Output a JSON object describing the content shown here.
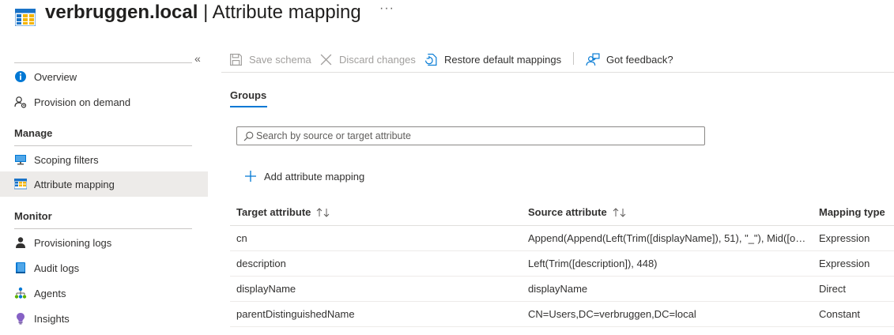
{
  "header": {
    "title_main": "verbruggen.local",
    "title_separator": "|",
    "title_sub": "Attribute mapping",
    "more": "···"
  },
  "sidebar": {
    "collapse_glyph": "«",
    "items": [
      {
        "label": "Overview",
        "icon": "info-icon"
      },
      {
        "label": "Provision on demand",
        "icon": "provision-icon"
      }
    ],
    "manage": {
      "heading": "Manage",
      "items": [
        {
          "label": "Scoping filters",
          "icon": "monitor-icon"
        },
        {
          "label": "Attribute mapping",
          "icon": "table-icon",
          "active": true
        }
      ]
    },
    "monitor": {
      "heading": "Monitor",
      "items": [
        {
          "label": "Provisioning logs",
          "icon": "person-icon"
        },
        {
          "label": "Audit logs",
          "icon": "book-icon"
        },
        {
          "label": "Agents",
          "icon": "org-icon"
        },
        {
          "label": "Insights",
          "icon": "lightbulb-icon"
        }
      ]
    }
  },
  "toolbar": {
    "save_label": "Save schema",
    "discard_label": "Discard changes",
    "restore_label": "Restore default mappings",
    "feedback_label": "Got feedback?"
  },
  "tab": {
    "label": "Groups"
  },
  "search": {
    "placeholder": "Search by source or target attribute"
  },
  "add_mapping_label": "Add attribute mapping",
  "table": {
    "headers": [
      "Target attribute",
      "Source attribute",
      "Mapping type"
    ],
    "rows": [
      [
        "cn",
        "Append(Append(Left(Trim([displayName]), 51), \"_\"), Mid([obj...",
        "Expression"
      ],
      [
        "description",
        "Left(Trim([description]), 448)",
        "Expression"
      ],
      [
        "displayName",
        "displayName",
        "Direct"
      ],
      [
        "parentDistinguishedName",
        "CN=Users,DC=verbruggen,DC=local",
        "Constant"
      ]
    ]
  },
  "colors": {
    "accent": "#0078d4",
    "active_bg": "#edebe9",
    "disabled_text": "#a19f9d"
  }
}
